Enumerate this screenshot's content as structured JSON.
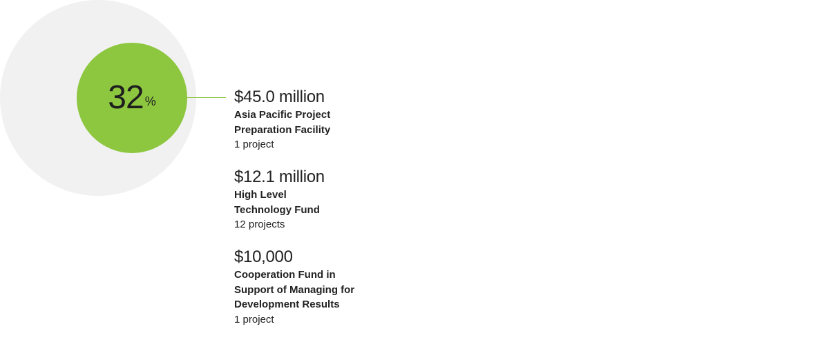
{
  "chart_data": {
    "type": "pie",
    "value_percent": 32,
    "value_label": "32",
    "percent_sign": "%",
    "entries": [
      {
        "amount": "$45.0 million",
        "fund": "Asia Pacific Project Preparation Facility",
        "projects": "1 project"
      },
      {
        "amount": "$12.1 million",
        "fund": "High Level Technology Fund",
        "projects": "12 projects"
      },
      {
        "amount": "$10,000",
        "fund": "Cooperation Fund in Support of Managing for Development Results",
        "projects": "1 project"
      }
    ]
  },
  "colors": {
    "accent_green": "#8dc63f",
    "background_circle": "#f1f1f1",
    "connector_line": "#8dc63f"
  }
}
